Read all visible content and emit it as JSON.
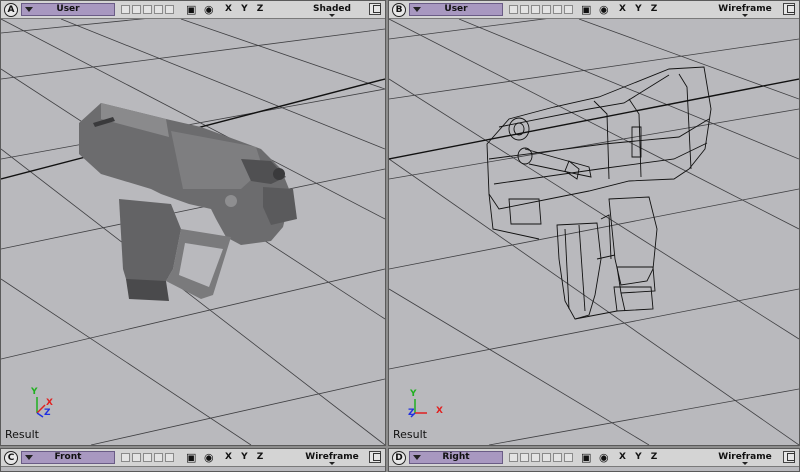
{
  "viewports": [
    {
      "letter": "A",
      "camera": "User",
      "axes": "X Y Z",
      "mode": "Shaded",
      "footer": "Result"
    },
    {
      "letter": "B",
      "camera": "User",
      "axes": "X Y Z",
      "mode": "Wireframe",
      "footer": "Result"
    },
    {
      "letter": "C",
      "camera": "Front",
      "axes": "X Y Z",
      "mode": "Wireframe"
    },
    {
      "letter": "D",
      "camera": "Right",
      "axes": "X Y Z",
      "mode": "Wireframe"
    }
  ],
  "axis_gizmo": {
    "x": "X",
    "y": "Y",
    "z": "Z"
  },
  "header_icons": [
    "camera-icon",
    "eye-icon"
  ],
  "colors": {
    "viewport_bg": "#b9b9bd",
    "header_bg": "#d4d4d4",
    "camera_dropdown": "#a898c0",
    "axis_x": "#e02020",
    "axis_y": "#20b020",
    "axis_z": "#2030e0"
  }
}
